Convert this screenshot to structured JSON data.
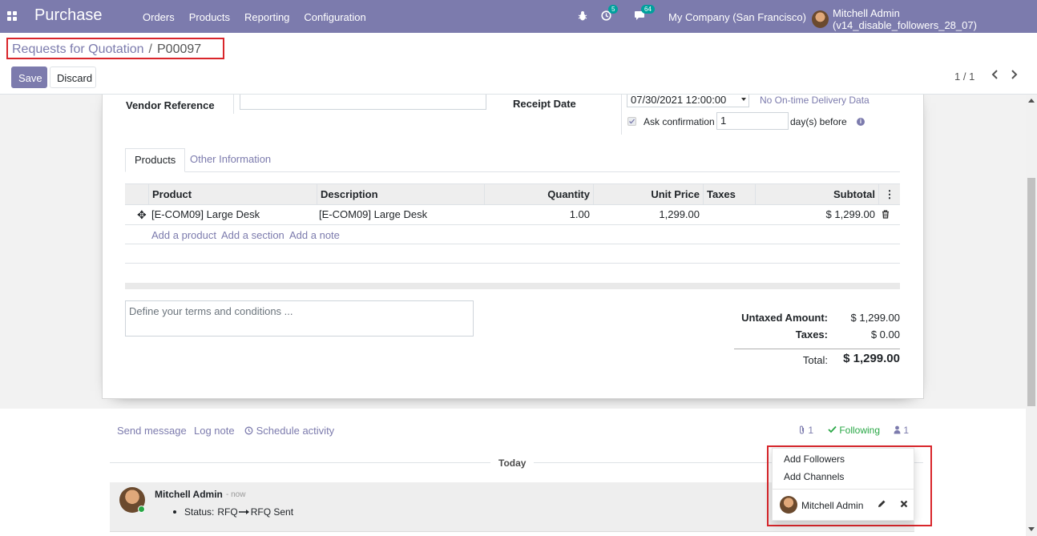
{
  "navbar": {
    "app_name": "Purchase",
    "menu": [
      "Orders",
      "Products",
      "Reporting",
      "Configuration"
    ],
    "activity_count": "5",
    "message_count": "64",
    "company": "My Company (San Francisco)",
    "user": "Mitchell Admin (v14_disable_followers_28_07)"
  },
  "control_panel": {
    "breadcrumb_parent": "Requests for Quotation",
    "breadcrumb_separator": "/",
    "breadcrumb_current": "P00097",
    "save_label": "Save",
    "discard_label": "Discard",
    "pager": "1 / 1"
  },
  "form": {
    "vendor_reference_label": "Vendor Reference",
    "vendor_reference_value": "",
    "receipt_date_label": "Receipt Date",
    "receipt_date_value": "07/30/2021 12:00:00",
    "on_time_link": "No On-time Delivery Data",
    "ask_confirmation_label": "Ask confirmation",
    "ask_confirmation_checked": true,
    "ask_confirmation_days": "1",
    "days_before_label": "day(s) before",
    "tabs": [
      "Products",
      "Other Information"
    ],
    "columns": [
      "Product",
      "Description",
      "Quantity",
      "Unit Price",
      "Taxes",
      "Subtotal"
    ],
    "lines": [
      {
        "product": "[E-COM09] Large Desk",
        "description": "[E-COM09] Large Desk",
        "quantity": "1.00",
        "unit_price": "1,299.00",
        "taxes": "",
        "subtotal": "$ 1,299.00"
      }
    ],
    "add_links": [
      "Add a product",
      "Add a section",
      "Add a note"
    ],
    "terms_placeholder": "Define your terms and conditions ...",
    "totals": {
      "untaxed_label": "Untaxed Amount:",
      "untaxed_value": "$ 1,299.00",
      "taxes_label": "Taxes:",
      "taxes_value": "$ 0.00",
      "total_label": "Total:",
      "total_value": "$ 1,299.00"
    }
  },
  "chatter": {
    "send_message": "Send message",
    "log_note": "Log note",
    "schedule_activity": "Schedule activity",
    "attachments_count": "1",
    "following_label": "Following",
    "followers_count": "1",
    "date_separator": "Today",
    "message": {
      "author": "Mitchell Admin",
      "time": "- now",
      "status_label": "Status:",
      "old_value": "RFQ",
      "new_value": "RFQ Sent"
    }
  },
  "followers_dropdown": {
    "add_followers": "Add Followers",
    "add_channels": "Add Channels",
    "follower_name": "Mitchell Admin"
  },
  "colors": {
    "brand": "#7c7bad",
    "highlight_border": "#d9262b",
    "following_green": "#28a745",
    "badge_teal": "#00a09d"
  }
}
